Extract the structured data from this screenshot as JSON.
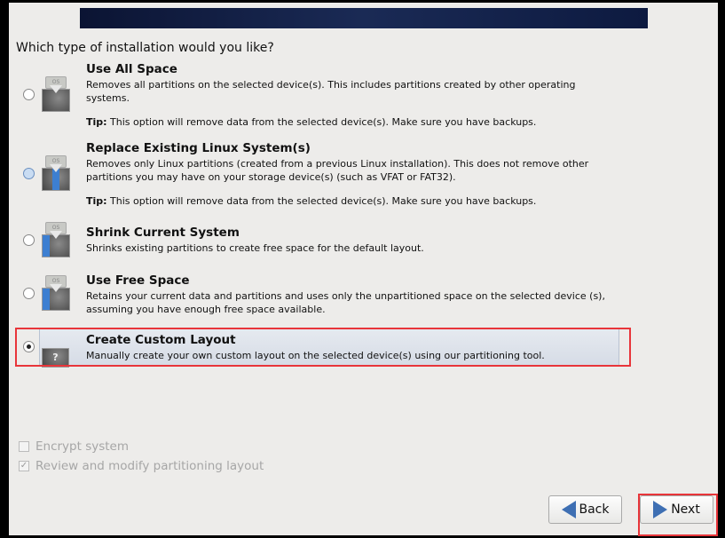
{
  "question": "Which type of installation would you like?",
  "options": [
    {
      "title": "Use All Space",
      "desc": "Removes all partitions on the selected device(s).  This includes partitions created by other operating systems.",
      "tip_label": "Tip:",
      "tip": " This option will remove data from the selected device(s).  Make sure you have backups.",
      "icon": "disk-erase-icon"
    },
    {
      "title": "Replace Existing Linux System(s)",
      "desc": "Removes only Linux partitions (created from a previous Linux installation).  This does not remove other partitions you may have on your storage device(s) (such as VFAT or FAT32).",
      "tip_label": "Tip:",
      "tip": " This option will remove data from the selected device(s).  Make sure you have backups.",
      "icon": "disk-replace-icon"
    },
    {
      "title": "Shrink Current System",
      "desc": "Shrinks existing partitions to create free space for the default layout.",
      "icon": "disk-shrink-icon"
    },
    {
      "title": "Use Free Space",
      "desc": "Retains your current data and partitions and uses only the unpartitioned space on the selected device (s), assuming you have enough free space available.",
      "icon": "disk-free-space-icon"
    },
    {
      "title": "Create Custom Layout",
      "desc": "Manually create your own custom layout on the selected device(s) using our partitioning tool.",
      "icon": "question-disk-icon",
      "selected": true
    }
  ],
  "icon_os_label": "OS",
  "icon_question": "?",
  "checkboxes": [
    {
      "label": "Encrypt system",
      "checked": false,
      "disabled": true
    },
    {
      "label": "Review and modify partitioning layout",
      "checked": true,
      "disabled": true
    }
  ],
  "buttons": {
    "back": "Back",
    "next": "Next"
  },
  "colors": {
    "highlight": "#e8353a",
    "banner": "#0b1433",
    "accent": "#3d7fd1"
  }
}
